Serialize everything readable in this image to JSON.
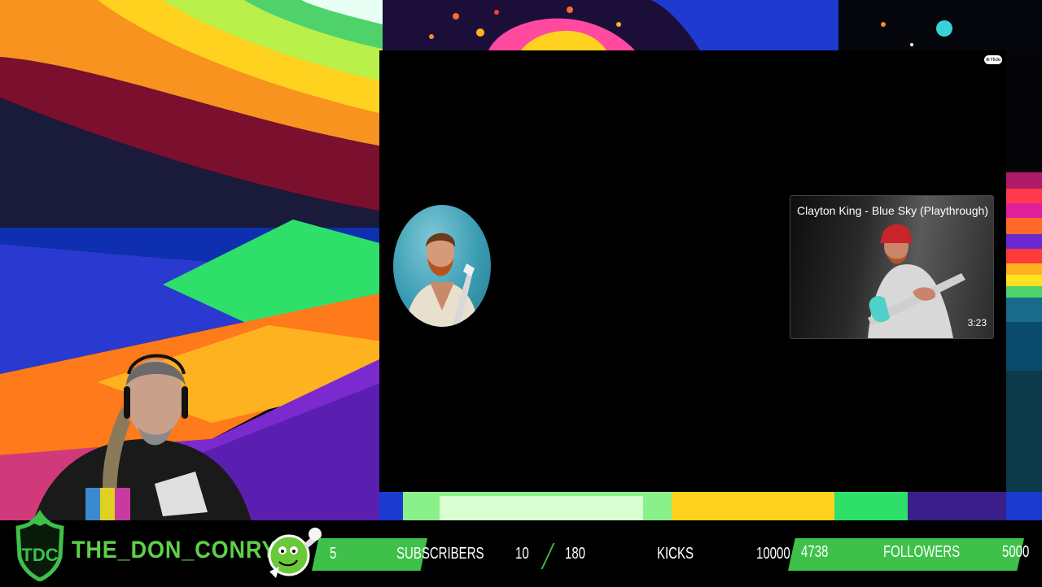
{
  "player": {
    "hide_label": "Hide",
    "video_card": {
      "title": "Clayton King - Blue Sky (Playthrough)",
      "duration": "3:23"
    }
  },
  "channel": {
    "logo_text": "TDC",
    "name": "THE_DON_CONRY"
  },
  "stats": {
    "subscribers_count": "5",
    "subscribers_label": "SUBSCRIBERS",
    "kicks_current": "10",
    "kicks_goal": "180",
    "kicks_label": "KICKS",
    "kicks_max": "10000",
    "followers_count": "4738",
    "followers_label": "FOLLOWERS",
    "followers_goal": "5000"
  },
  "colors": {
    "accent_green": "#3fc04a",
    "name_green": "#5fd048",
    "background": "#000000"
  }
}
